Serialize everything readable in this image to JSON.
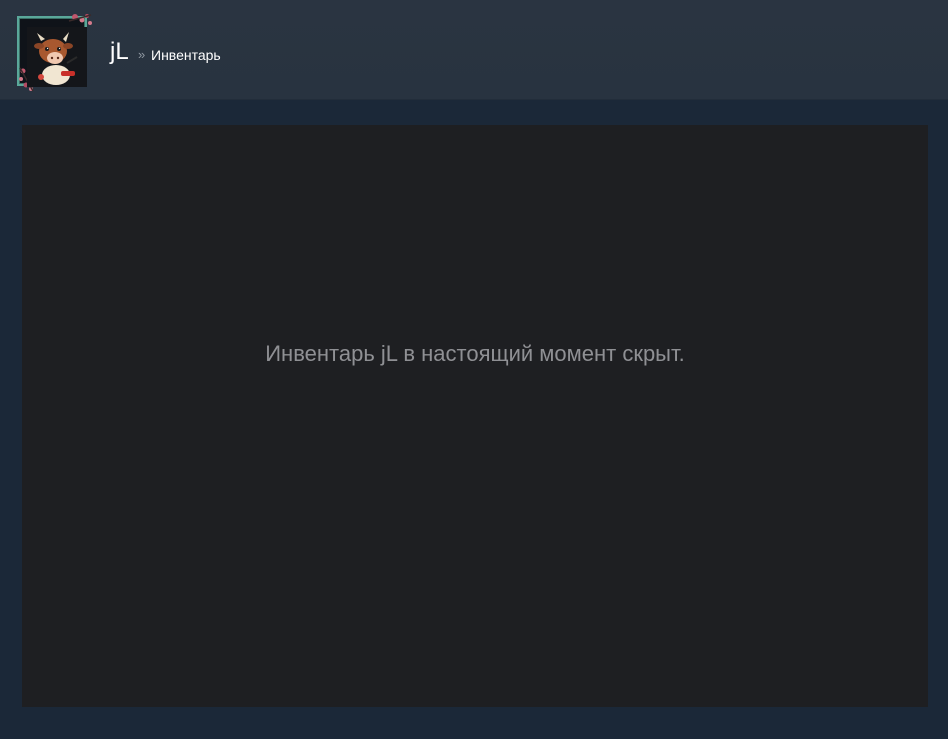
{
  "header": {
    "persona_name": "jL",
    "breadcrumb_separator": "»",
    "breadcrumb_page": "Инвентарь",
    "avatar": {
      "icon": "cartoon-cow-avatar-icon",
      "frame_color": "#5aa89a"
    }
  },
  "inventory": {
    "hidden_message": "Инвентарь jL в настоящий момент скрыт."
  },
  "colors": {
    "page_background": "#1b2838",
    "header_background": "#2a3441",
    "panel_background": "#1e1f22",
    "message_text": "#8f9094",
    "breadcrumb_separator": "#8f98a0"
  }
}
